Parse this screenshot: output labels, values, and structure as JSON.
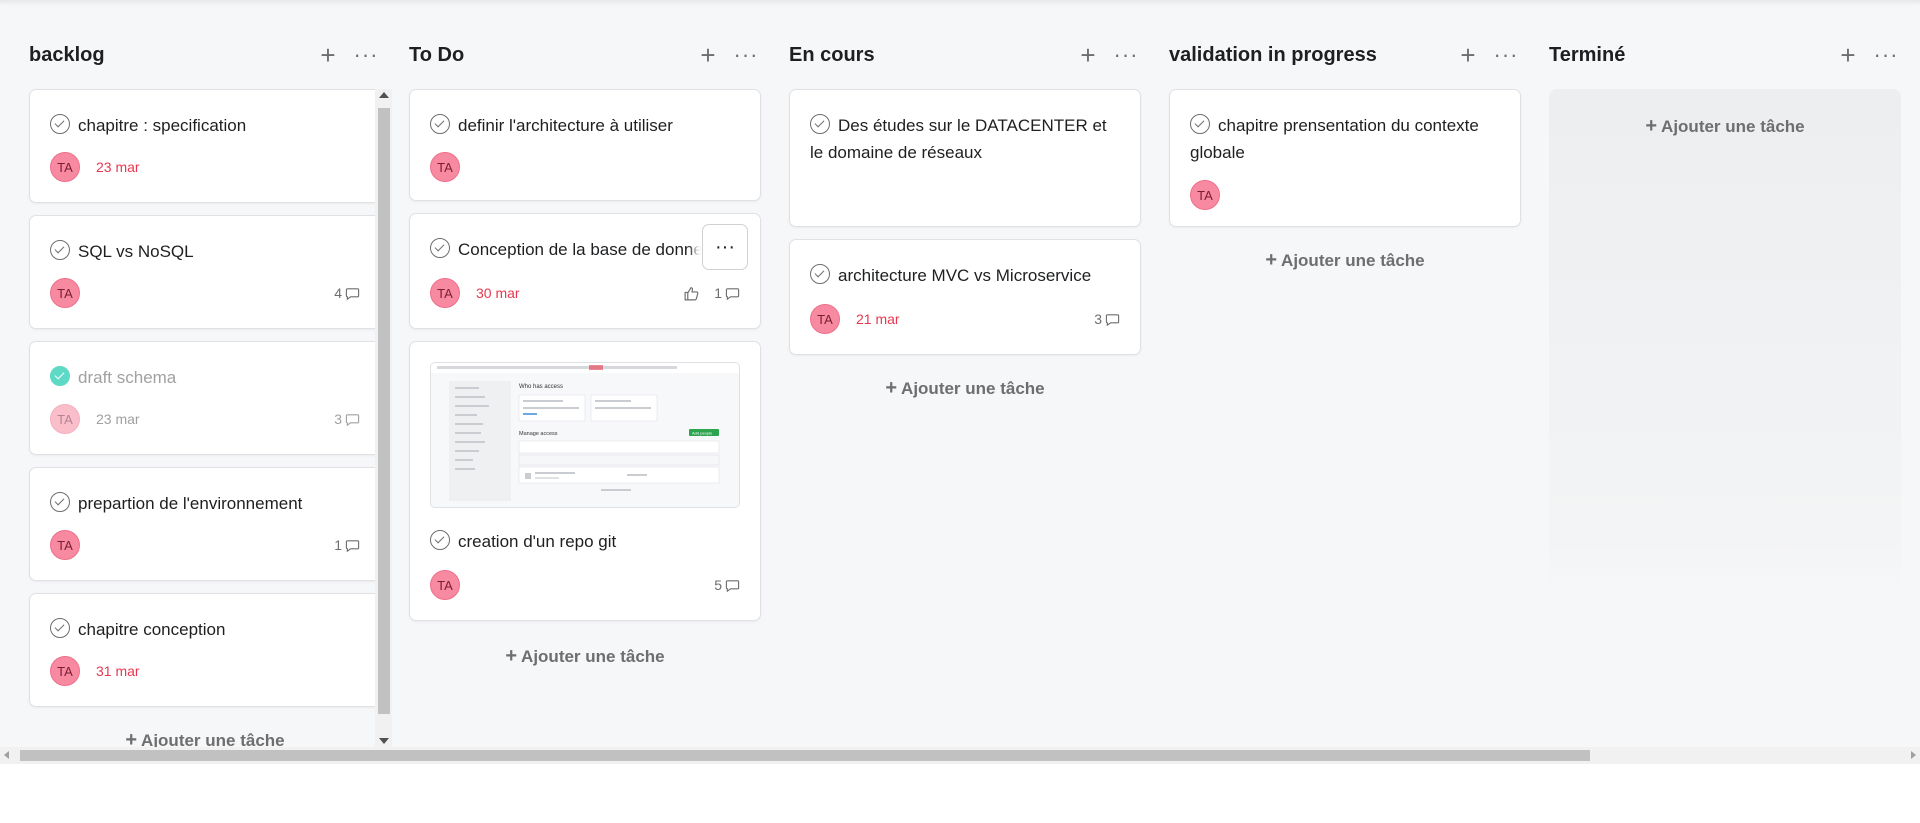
{
  "board": {
    "add_task_label": "Ajouter une tâche",
    "columns": [
      {
        "title": "backlog",
        "cards": [
          {
            "title": "chapitre : specification",
            "assignee": "TA",
            "due": "23 mar",
            "comments": ""
          },
          {
            "title": "SQL vs NoSQL",
            "assignee": "TA",
            "due": "",
            "comments": "4"
          },
          {
            "title": "draft schema",
            "assignee": "TA",
            "due": "23 mar",
            "comments": "3",
            "completed": true
          },
          {
            "title": "prepartion de l'environnement",
            "assignee": "TA",
            "due": "",
            "comments": "1"
          },
          {
            "title": "chapitre conception",
            "assignee": "TA",
            "due": "31 mar",
            "comments": ""
          }
        ]
      },
      {
        "title": "To Do",
        "cards": [
          {
            "title": "definir l'architecture à utiliser",
            "assignee": "TA",
            "due": "",
            "comments": ""
          },
          {
            "title": "Conception de la base de donne",
            "assignee": "TA",
            "due": "30 mar",
            "likes": "",
            "comments": "1"
          },
          {
            "title": "creation d'un repo git",
            "assignee": "TA",
            "due": "",
            "comments": "5",
            "has_image": true
          }
        ]
      },
      {
        "title": "En cours",
        "cards": [
          {
            "title": "Des études sur le DATACENTER et le domaine de réseaux",
            "assignee": "",
            "due": "",
            "comments": ""
          },
          {
            "title": "architecture MVC vs Microservice",
            "assignee": "TA",
            "due": "21 mar",
            "comments": "3"
          }
        ]
      },
      {
        "title": "validation in progress",
        "cards": [
          {
            "title": "chapitre prensentation du contexte globale",
            "assignee": "TA",
            "due": "",
            "comments": ""
          }
        ]
      },
      {
        "title": "Terminé",
        "cards": []
      }
    ]
  },
  "thumbnail": {
    "heading": "Who has access",
    "section": "Manage access",
    "button": "Add people"
  },
  "icons": {
    "add": "plus-icon",
    "more": "more-horizontal-icon",
    "check": "check-circle-icon",
    "comment": "comment-icon",
    "like": "thumbs-up-icon"
  },
  "colors": {
    "avatar": "#f78aa1",
    "due_overdue": "#e8384f",
    "completed_check": "#5ed9c6"
  }
}
